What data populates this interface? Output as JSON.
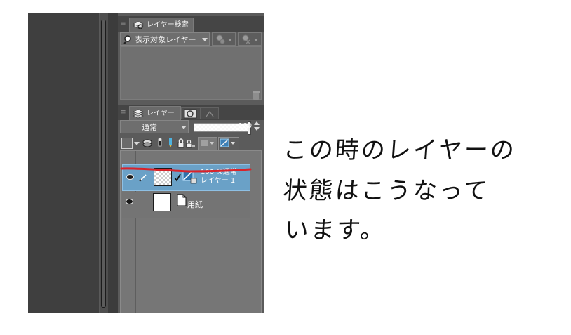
{
  "layer_search_panel": {
    "tab_label": "レイヤー検索",
    "filter_dropdown": "表示対象レイヤー"
  },
  "layer_panel": {
    "tab_label": "レイヤー",
    "blend_mode": "通常",
    "opacity": "100",
    "layers": [
      {
        "info": "100 %通常",
        "name": "レイヤー 1",
        "selected": true
      },
      {
        "info": "",
        "name": "用紙",
        "selected": false
      }
    ]
  },
  "handwritten_note": {
    "lines": [
      "この時のレイヤーの",
      "状態はこうなって",
      "います。"
    ]
  },
  "colors": {
    "panel_bg": "#5b5b5b",
    "selected_row": "#6aa1c7",
    "annotation_underline": "#d9232a"
  }
}
